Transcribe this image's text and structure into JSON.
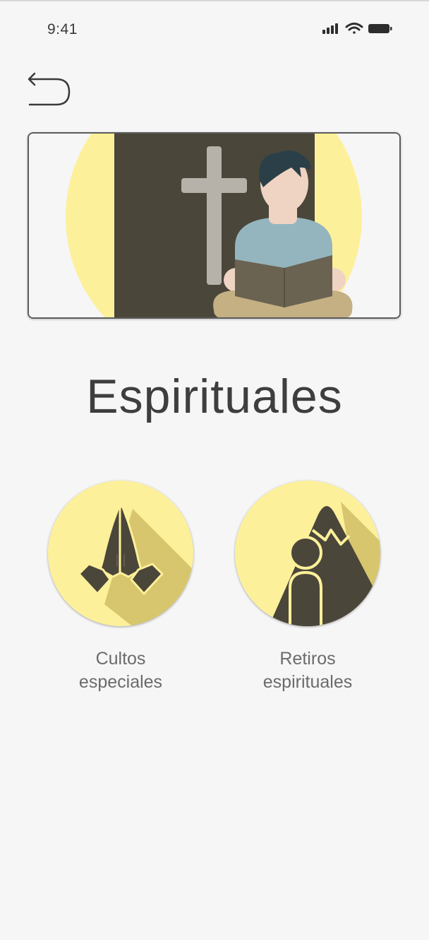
{
  "status_bar": {
    "time": "9:41",
    "icons": [
      "cellular-signal-icon",
      "wifi-icon",
      "battery-icon"
    ]
  },
  "header": {
    "back_icon": "back-arrow-icon"
  },
  "hero": {
    "illustration": "person-reading-bible-with-cross"
  },
  "page": {
    "title": "Espirituales"
  },
  "categories": [
    {
      "label_line1": "Cultos",
      "label_line2": "especiales",
      "icon": "praying-hands-icon"
    },
    {
      "label_line1": "Retiros",
      "label_line2": "espirituales",
      "icon": "person-mountain-icon"
    }
  ],
  "colors": {
    "background": "#f6f6f6",
    "accent_yellow": "#fdf09a",
    "dark_olive": "#4a463a",
    "shadow_yellow": "#d7c66e",
    "text": "#404040"
  }
}
